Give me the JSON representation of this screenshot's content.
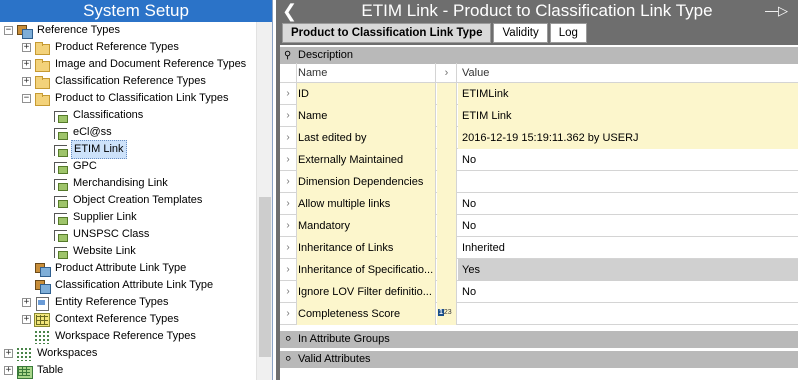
{
  "left": {
    "title": "System Setup",
    "tree": [
      {
        "label": "Reference Types",
        "icon": "reference-types-icon",
        "expander": "−",
        "level": 1
      },
      {
        "label": "Product Reference Types",
        "icon": "folder-icon",
        "expander": "+",
        "level": 2
      },
      {
        "label": "Image and Document Reference Types",
        "icon": "image-doc-folder-icon",
        "expander": "+",
        "level": 2
      },
      {
        "label": "Classification Reference Types",
        "icon": "folder-icon",
        "expander": "+",
        "level": 2
      },
      {
        "label": "Product to Classification Link Types",
        "icon": "folder-icon",
        "expander": "−",
        "level": 2
      },
      {
        "label": "Classifications",
        "icon": "link-type-icon",
        "expander": "",
        "level": 3
      },
      {
        "label": "eCl@ss",
        "icon": "link-type-icon",
        "expander": "",
        "level": 3
      },
      {
        "label": "ETIM Link",
        "icon": "link-type-icon",
        "expander": "",
        "level": 3,
        "selected": true
      },
      {
        "label": "GPC",
        "icon": "link-type-icon",
        "expander": "",
        "level": 3
      },
      {
        "label": "Merchandising Link",
        "icon": "link-type-icon",
        "expander": "",
        "level": 3
      },
      {
        "label": "Object Creation Templates",
        "icon": "link-type-icon",
        "expander": "",
        "level": 3
      },
      {
        "label": "Supplier Link",
        "icon": "link-type-icon",
        "expander": "",
        "level": 3
      },
      {
        "label": "UNSPSC Class",
        "icon": "link-type-icon",
        "expander": "",
        "level": 3
      },
      {
        "label": "Website Link",
        "icon": "link-type-icon",
        "expander": "",
        "level": 3
      },
      {
        "label": "Product Attribute Link Type",
        "icon": "attribute-link-icon",
        "expander": "",
        "level": 2
      },
      {
        "label": "Classification Attribute Link Type",
        "icon": "attribute-link-icon",
        "expander": "",
        "level": 2
      },
      {
        "label": "Entity Reference Types",
        "icon": "doc-folder-icon",
        "expander": "+",
        "level": 2
      },
      {
        "label": "Context Reference Types",
        "icon": "yellow-grid-icon",
        "expander": "+",
        "level": 2
      },
      {
        "label": "Workspace Reference Types",
        "icon": "workspace-ref-icon",
        "expander": "",
        "level": 2
      },
      {
        "label": "Workspaces",
        "icon": "workspaces-icon",
        "expander": "+",
        "level": 1
      },
      {
        "label": "Table",
        "icon": "table-icon",
        "expander": "+",
        "level": 1
      }
    ]
  },
  "right": {
    "title": "ETIM Link - Product to Classification Link Type",
    "tabs": [
      "Product to Classification Link Type",
      "Validity",
      "Log"
    ],
    "description_section": "Description",
    "columns": {
      "name": "Name",
      "value": "Value"
    },
    "rows": [
      {
        "name": "ID",
        "value": "ETIMLink",
        "style": "yellow"
      },
      {
        "name": "Name",
        "value": "ETIM Link",
        "style": "yellow"
      },
      {
        "name": "Last edited by",
        "value": "2016-12-19 15:19:11.362 by USERJ",
        "style": "yellow"
      },
      {
        "name": "Externally Maintained",
        "value": "No",
        "style": "yellow-name"
      },
      {
        "name": "Dimension Dependencies",
        "value": "",
        "style": "yellow-name"
      },
      {
        "name": "Allow multiple links",
        "value": "No",
        "style": "yellow-name"
      },
      {
        "name": "Mandatory",
        "value": "No",
        "style": "yellow-name"
      },
      {
        "name": "Inheritance of Links",
        "value": "Inherited",
        "style": "yellow-name"
      },
      {
        "name": "Inheritance of Specificatio...",
        "value": "Yes",
        "style": "gray"
      },
      {
        "name": "Ignore LOV Filter definitio...",
        "value": "No",
        "style": "yellow-name"
      },
      {
        "name": "Completeness Score",
        "value": "",
        "style": "yellow-name",
        "mid_icon": "number-type-icon"
      }
    ],
    "sections_below": [
      "In Attribute Groups",
      "Valid Attributes"
    ]
  }
}
